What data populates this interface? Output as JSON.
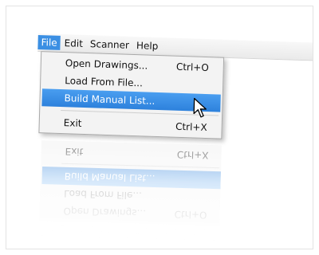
{
  "menubar": {
    "items": [
      {
        "label": "File"
      },
      {
        "label": "Edit"
      },
      {
        "label": "Scanner"
      },
      {
        "label": "Help"
      }
    ]
  },
  "file_menu": {
    "items": [
      {
        "label": "Open Drawings...",
        "shortcut": "Ctrl+O"
      },
      {
        "label": "Load From File...",
        "shortcut": ""
      },
      {
        "label": "Build Manual List...",
        "shortcut": ""
      },
      {
        "label": "Exit",
        "shortcut": "Ctrl+X"
      }
    ]
  },
  "colors": {
    "highlight": "#3b8fe3",
    "menu_background": "#f3f3f3"
  }
}
